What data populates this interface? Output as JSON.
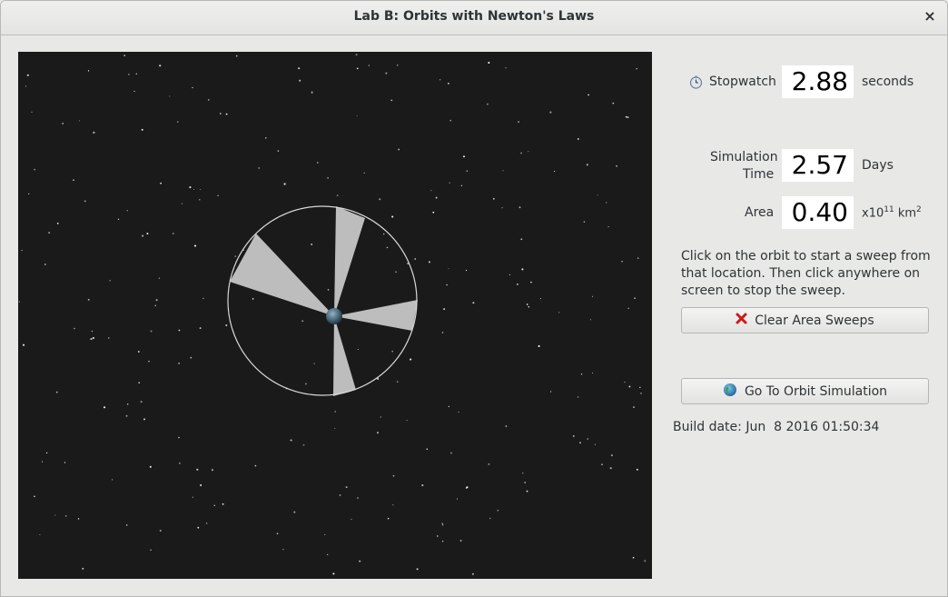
{
  "window": {
    "title": "Lab B: Orbits with Newton's Laws",
    "close_glyph": "×"
  },
  "stopwatch": {
    "label": "Stopwatch",
    "value": "2.88",
    "unit": "seconds"
  },
  "simulation_time": {
    "label_line1": "Simulation",
    "label_line2": "Time",
    "value": "2.57",
    "unit": "Days"
  },
  "area": {
    "label": "Area",
    "value": "0.40",
    "unit_base": "x10",
    "unit_exp": "11",
    "unit_mid": " km",
    "unit_exp2": "2"
  },
  "instructions": "Click on the orbit to start a sweep from that location. Then click anywhere on screen to stop the sweep.",
  "buttons": {
    "clear_sweeps": "Clear Area Sweeps",
    "go_orbit": "Go To Orbit Simulation"
  },
  "build_date": "Build date: Jun  8 2016 01:50:34",
  "icons": {
    "stopwatch": "stopwatch-icon",
    "clear": "red-x-icon",
    "globe": "globe-icon"
  },
  "colors": {
    "sim_bg": "#1a1a1a",
    "sweep": "#bdbdbd",
    "orbit": "#d8d8d8",
    "clear_icon": "#cc1a1a"
  }
}
